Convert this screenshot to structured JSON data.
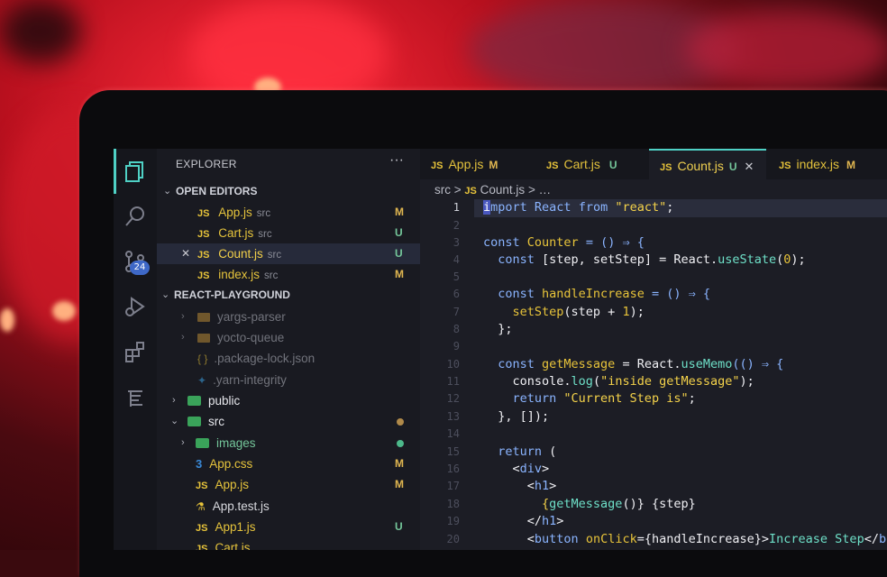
{
  "sidebar": {
    "title": "EXPLORER",
    "more": "···",
    "open_editors_label": "OPEN EDITORS",
    "open_editors": [
      {
        "name": "App.js",
        "dir": "src",
        "status": "M"
      },
      {
        "name": "Cart.js",
        "dir": "src",
        "status": "U"
      },
      {
        "name": "Count.js",
        "dir": "src",
        "status": "U",
        "close": "✕"
      },
      {
        "name": "index.js",
        "dir": "src",
        "status": "M"
      }
    ],
    "project_label": "REACT-PLAYGROUND",
    "tree": [
      {
        "name": "yargs-parser"
      },
      {
        "name": "yocto-queue"
      },
      {
        "name": ".package-lock.json"
      },
      {
        "name": ".yarn-integrity"
      },
      {
        "name": "public"
      },
      {
        "name": "src"
      },
      {
        "name": "images"
      },
      {
        "name": "App.css",
        "status": "M"
      },
      {
        "name": "App.js",
        "status": "M"
      },
      {
        "name": "App.test.js"
      },
      {
        "name": "App1.js",
        "status": "U"
      },
      {
        "name": "Cart.js"
      }
    ],
    "scm_badge": "24"
  },
  "tabs": [
    {
      "name": "App.js",
      "status": "M"
    },
    {
      "name": "Cart.js",
      "status": "U"
    },
    {
      "name": "Count.js",
      "status": "U",
      "close": "✕"
    },
    {
      "name": "index.js",
      "status": "M"
    }
  ],
  "breadcrumb": {
    "folder": "src",
    "sep": ">",
    "file": "Count.js",
    "more": "> …"
  },
  "code_lines": [
    {
      "n": "1"
    },
    {
      "n": "2"
    },
    {
      "n": "3"
    },
    {
      "n": "4"
    },
    {
      "n": "5"
    },
    {
      "n": "6"
    },
    {
      "n": "7"
    },
    {
      "n": "8"
    },
    {
      "n": "9"
    },
    {
      "n": "10"
    },
    {
      "n": "11"
    },
    {
      "n": "12"
    },
    {
      "n": "13"
    },
    {
      "n": "14"
    },
    {
      "n": "15"
    },
    {
      "n": "16"
    },
    {
      "n": "17"
    },
    {
      "n": "18"
    },
    {
      "n": "19"
    },
    {
      "n": "20"
    }
  ],
  "code": {
    "l1a": "i",
    "l1b": "mport React ",
    "l1c": "from ",
    "l1d": "\"react\"",
    "l1e": ";",
    "l3a": "const ",
    "l3b": "Counter ",
    "l3c": "= () ⇒ {",
    "l4a": "  const ",
    "l4b": "[step, setStep] = React.",
    "l4c": "useState",
    "l4d": "(",
    "l4e": "0",
    "l4f": ");",
    "l6a": "  const ",
    "l6b": "handleIncrease ",
    "l6c": "= () ⇒ {",
    "l7a": "    setStep",
    "l7b": "(step + ",
    "l7c": "1",
    "l7d": ");",
    "l8": "  };",
    "l10a": "  const ",
    "l10b": "getMessage ",
    "l10c": "= React.",
    "l10d": "useMemo",
    "l10e": "(() ⇒ {",
    "l11a": "    console.",
    "l11b": "log",
    "l11c": "(",
    "l11d": "\"inside getMessage\"",
    "l11e": ");",
    "l12a": "    return ",
    "l12b": "\"Current Step is\"",
    "l12c": ";",
    "l13": "  }, []);",
    "l15a": "  return ",
    "l15b": "(",
    "l16a": "    <",
    "l16b": "div",
    "l16c": ">",
    "l17a": "      <",
    "l17b": "h1",
    "l17c": ">",
    "l18a": "        {",
    "l18b": "getMessage",
    "l18c": "()} {step}",
    "l19a": "      </",
    "l19b": "h1",
    "l19c": ">",
    "l20a": "      <",
    "l20b": "button ",
    "l20c": "onClick",
    "l20d": "={handleIncrease}>",
    "l20e": "Increase Step",
    "l20f": "</",
    "l20g": "bu"
  },
  "icons": [
    "files-icon",
    "search-icon",
    "source-control-icon",
    "run-debug-icon",
    "extensions-icon",
    "timeline-icon"
  ]
}
